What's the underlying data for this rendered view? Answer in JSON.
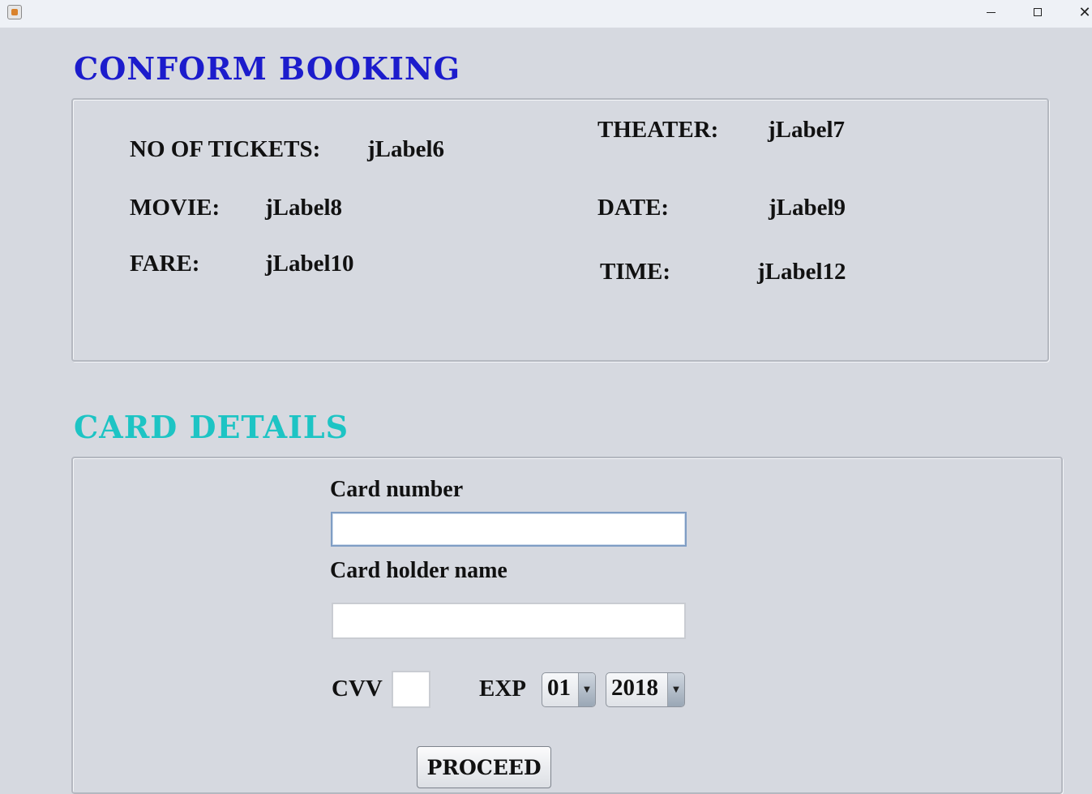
{
  "window": {
    "app_icon": "java-cup-icon",
    "minimize_icon": "minimize-icon",
    "maximize_icon": "maximize-icon",
    "close_icon": "close-icon",
    "close_glyph": "✕"
  },
  "booking": {
    "heading": "CONFORM BOOKING",
    "heading_color": "#1c1ccc",
    "tickets_label": "NO OF TICKETS:",
    "tickets_value": "jLabel6",
    "theater_label": "THEATER:",
    "theater_value": "jLabel7",
    "movie_label": "MOVIE:",
    "movie_value": "jLabel8",
    "date_label": "DATE:",
    "date_value": "jLabel9",
    "fare_label": "FARE:",
    "fare_value": "jLabel10",
    "time_label": "TIME:",
    "time_value": "jLabel12"
  },
  "card": {
    "heading": "CARD DETAILS",
    "heading_color": "#1dc4c4",
    "number_label": "Card number",
    "number_value": "",
    "holder_label": "Card holder name",
    "holder_value": "",
    "cvv_label": "CVV",
    "cvv_value": "",
    "exp_label": "EXP",
    "exp_month": "01",
    "exp_year": "2018",
    "dropdown_arrow": "▼",
    "proceed_label": "PROCEED"
  }
}
